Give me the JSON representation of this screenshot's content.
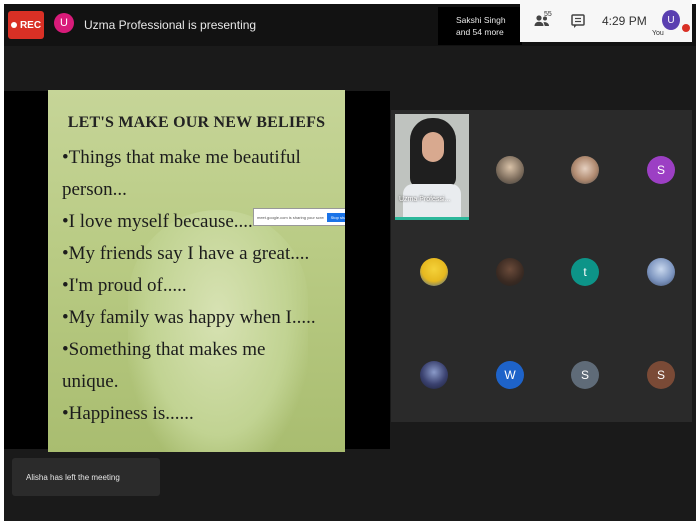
{
  "topbar": {
    "rec_label": "REC",
    "presenter_initial": "U",
    "presenter_text": "Uzma Professional is presenting",
    "viewers_line1": "Sakshi Singh",
    "viewers_line2": "and 54 more",
    "people_count": "55",
    "time": "4:29 PM",
    "you_initial": "U",
    "you_label": "You"
  },
  "slide": {
    "title": "LET'S MAKE OUR NEW BELIEFS",
    "bullets": [
      "•Things that make me beautiful",
      "person...",
      "•I love myself because....",
      "•My friends say I have a great....",
      "•I'm proud of.....",
      "•My family was happy when I.....",
      "•Something that makes me",
      "unique.",
      "•Happiness is......"
    ],
    "popup_text": "meet.google.com is sharing your screen",
    "popup_button": "Stop sharing",
    "popup_close": "×"
  },
  "tiles": {
    "self_label": "Uzma Professi...",
    "letters": {
      "s1": "S",
      "t": "t",
      "w": "W",
      "s2": "S",
      "s3": "S"
    }
  },
  "toast": {
    "text": "Alisha has left the meeting"
  },
  "colors": {
    "rec": "#d93025",
    "presenter_avatar": "#d81b7a",
    "accent_teal": "#2cb79a",
    "slide_green": "#b9cb84"
  },
  "icons": {
    "people": "people-icon",
    "chat": "chat-icon",
    "rec_dot": "record-dot-icon"
  }
}
